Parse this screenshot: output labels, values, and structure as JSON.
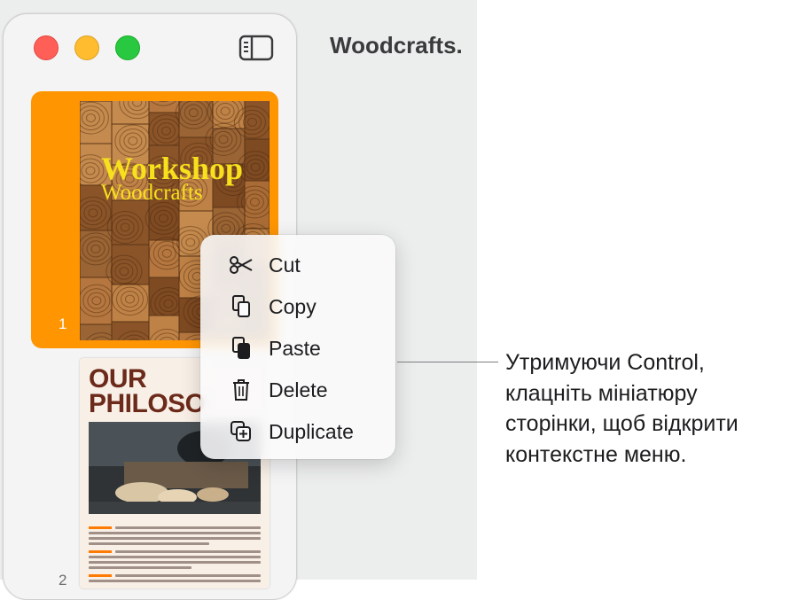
{
  "window": {
    "title": "Woodcrafts."
  },
  "sidebar": {
    "pages": [
      {
        "number": "1",
        "title": "Workshop",
        "subtitle": "Woodcrafts"
      },
      {
        "number": "2",
        "heading_line1": "OUR",
        "heading_line2": "PHILOSO"
      }
    ]
  },
  "context_menu": {
    "items": [
      {
        "label": "Cut",
        "icon": "scissors-icon"
      },
      {
        "label": "Copy",
        "icon": "copy-icon"
      },
      {
        "label": "Paste",
        "icon": "paste-icon"
      },
      {
        "label": "Delete",
        "icon": "trash-icon"
      },
      {
        "label": "Duplicate",
        "icon": "duplicate-icon"
      }
    ]
  },
  "callout": {
    "line1": "Утримуючи Control,",
    "line2": "клацніть мініатюру",
    "line3": "сторінки, щоб відкрити",
    "line4": "контекстне меню."
  },
  "colors": {
    "selection": "#ff9500",
    "cover_text": "#f7e11d",
    "close": "#ff5f57",
    "minimize": "#febc2e",
    "zoom": "#28c840"
  }
}
